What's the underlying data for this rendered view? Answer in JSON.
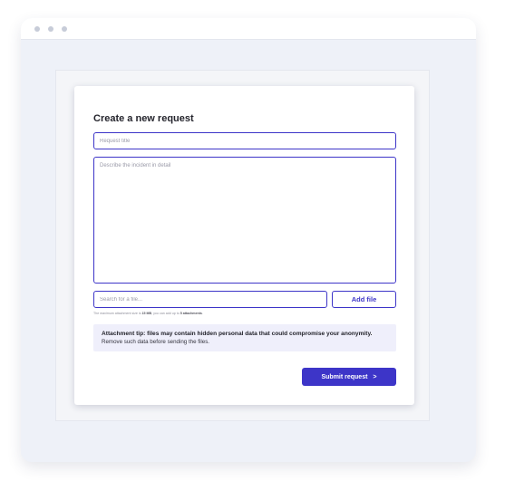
{
  "form": {
    "title": "Create a new request",
    "request_title_placeholder": "Request title",
    "description_placeholder": "Describe the incident in detail",
    "search_placeholder": "Search for a file...",
    "add_file_label": "Add file",
    "attachment_note": {
      "prefix": "The maximum attachment size is ",
      "max_size": "15 MB",
      "middle": ", you can add up to ",
      "max_count": "5 attachments",
      "suffix": "."
    },
    "tip": {
      "headline": "Attachment tip: files may contain hidden personal data that could compromise your anonymity.",
      "detail": "Remove such data before sending the files."
    },
    "submit_label": "Submit request",
    "submit_icon": ">"
  },
  "colors": {
    "accent": "#3d35c8",
    "tip_background": "#efeffb",
    "frame_background": "#eef1f8"
  },
  "icons": {
    "window_controls": "window-dot-icon",
    "submit": "chevron-right-icon"
  }
}
